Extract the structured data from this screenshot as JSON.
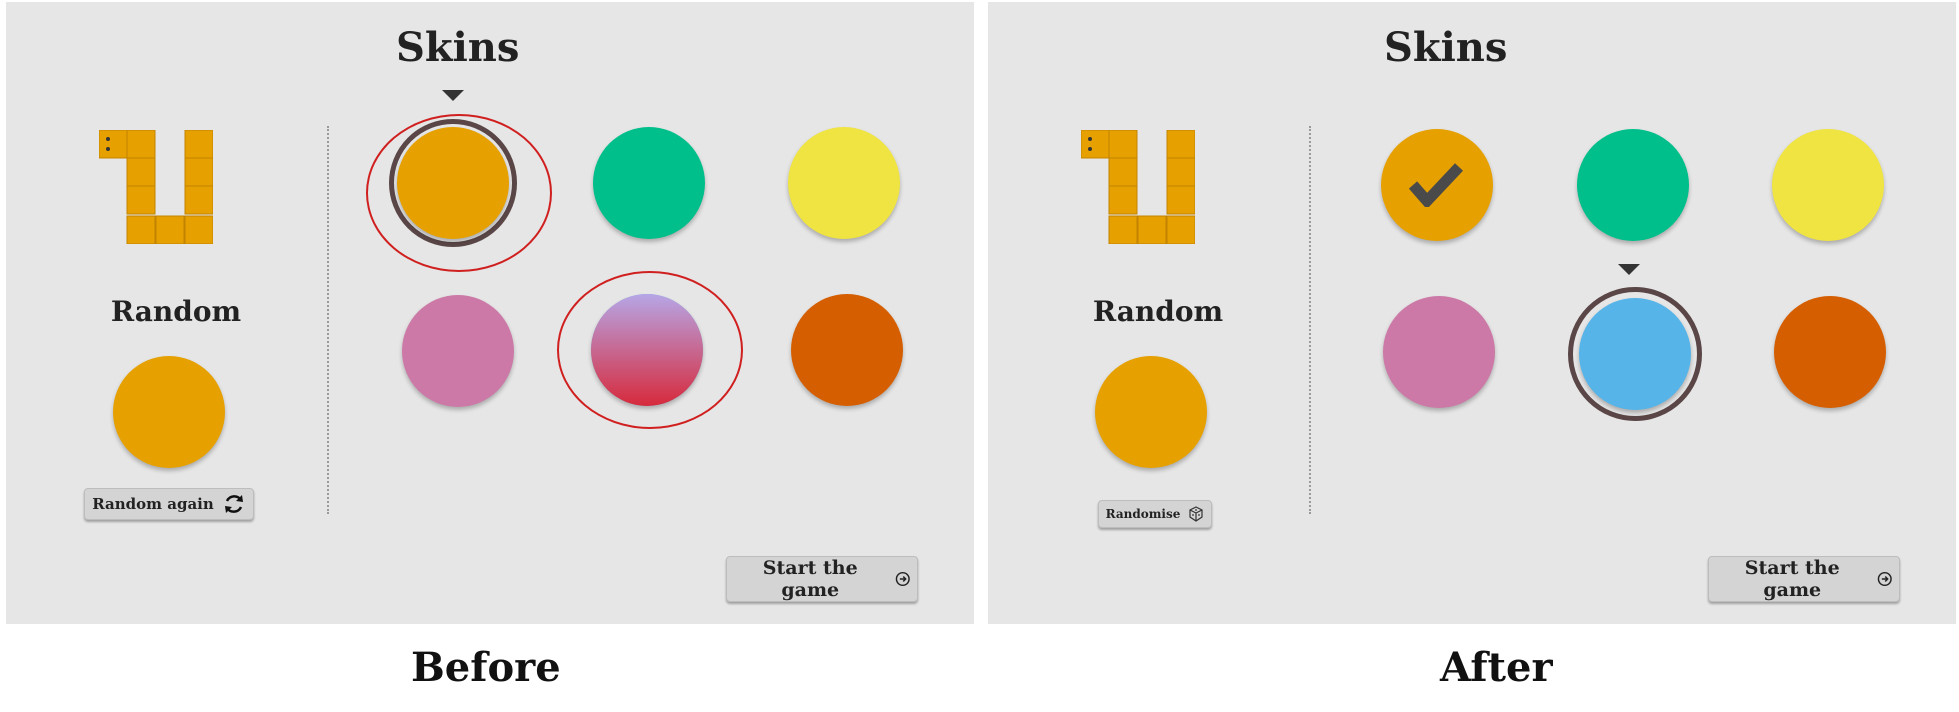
{
  "panels": {
    "before": {
      "title": "Skins",
      "random_label": "Random",
      "random_button_label": "Random again",
      "random_button_icon": "refresh-icon",
      "start_button_label": "Start the game",
      "start_button_icon": "arrow-circle-right-icon",
      "selected_skin": 0,
      "hovered_skin": 4
    },
    "after": {
      "title": "Skins",
      "random_label": "Random",
      "random_button_label": "Randomise",
      "random_button_icon": "dice-icon",
      "start_button_label": "Start the game",
      "start_button_icon": "arrow-circle-right-icon",
      "checked_skin": 0,
      "selected_skin": 4
    }
  },
  "skins": [
    {
      "name": "orange",
      "color": "#e6a000"
    },
    {
      "name": "green",
      "color": "#00bf8a"
    },
    {
      "name": "yellow",
      "color": "#f0e442"
    },
    {
      "name": "pink",
      "color": "#cc79a7"
    },
    {
      "name": "blue",
      "color": "#56b4e9"
    },
    {
      "name": "red-orange",
      "color": "#d55e00"
    }
  ],
  "random_skin_color": "#e6a000",
  "snake_color": "#e6a000",
  "captions": {
    "before": "Before",
    "after": "After"
  },
  "colors": {
    "annotation": "#d01f1f",
    "selection_ring": "#5a4646",
    "panel_bg": "#e6e6e6"
  }
}
